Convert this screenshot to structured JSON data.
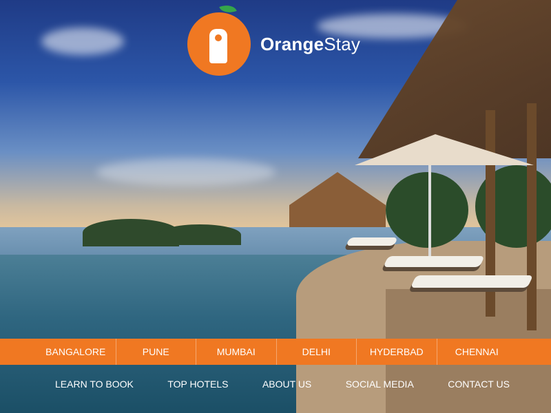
{
  "brand": {
    "name_bold": "Orange",
    "name_light": "Stay"
  },
  "cities": [
    {
      "label": "BANGALORE"
    },
    {
      "label": "PUNE"
    },
    {
      "label": "MUMBAI"
    },
    {
      "label": "DELHI"
    },
    {
      "label": "HYDERBAD"
    },
    {
      "label": "CHENNAI"
    }
  ],
  "footer_links": [
    {
      "label": "LEARN TO BOOK"
    },
    {
      "label": "TOP HOTELS"
    },
    {
      "label": "ABOUT US"
    },
    {
      "label": "SOCIAL MEDIA"
    },
    {
      "label": "CONTACT US"
    }
  ],
  "colors": {
    "accent": "#f07822",
    "leaf": "#35a64a",
    "text": "#ffffff"
  },
  "icons": {
    "logo": "door-hanger-icon",
    "leaf": "leaf-icon"
  }
}
